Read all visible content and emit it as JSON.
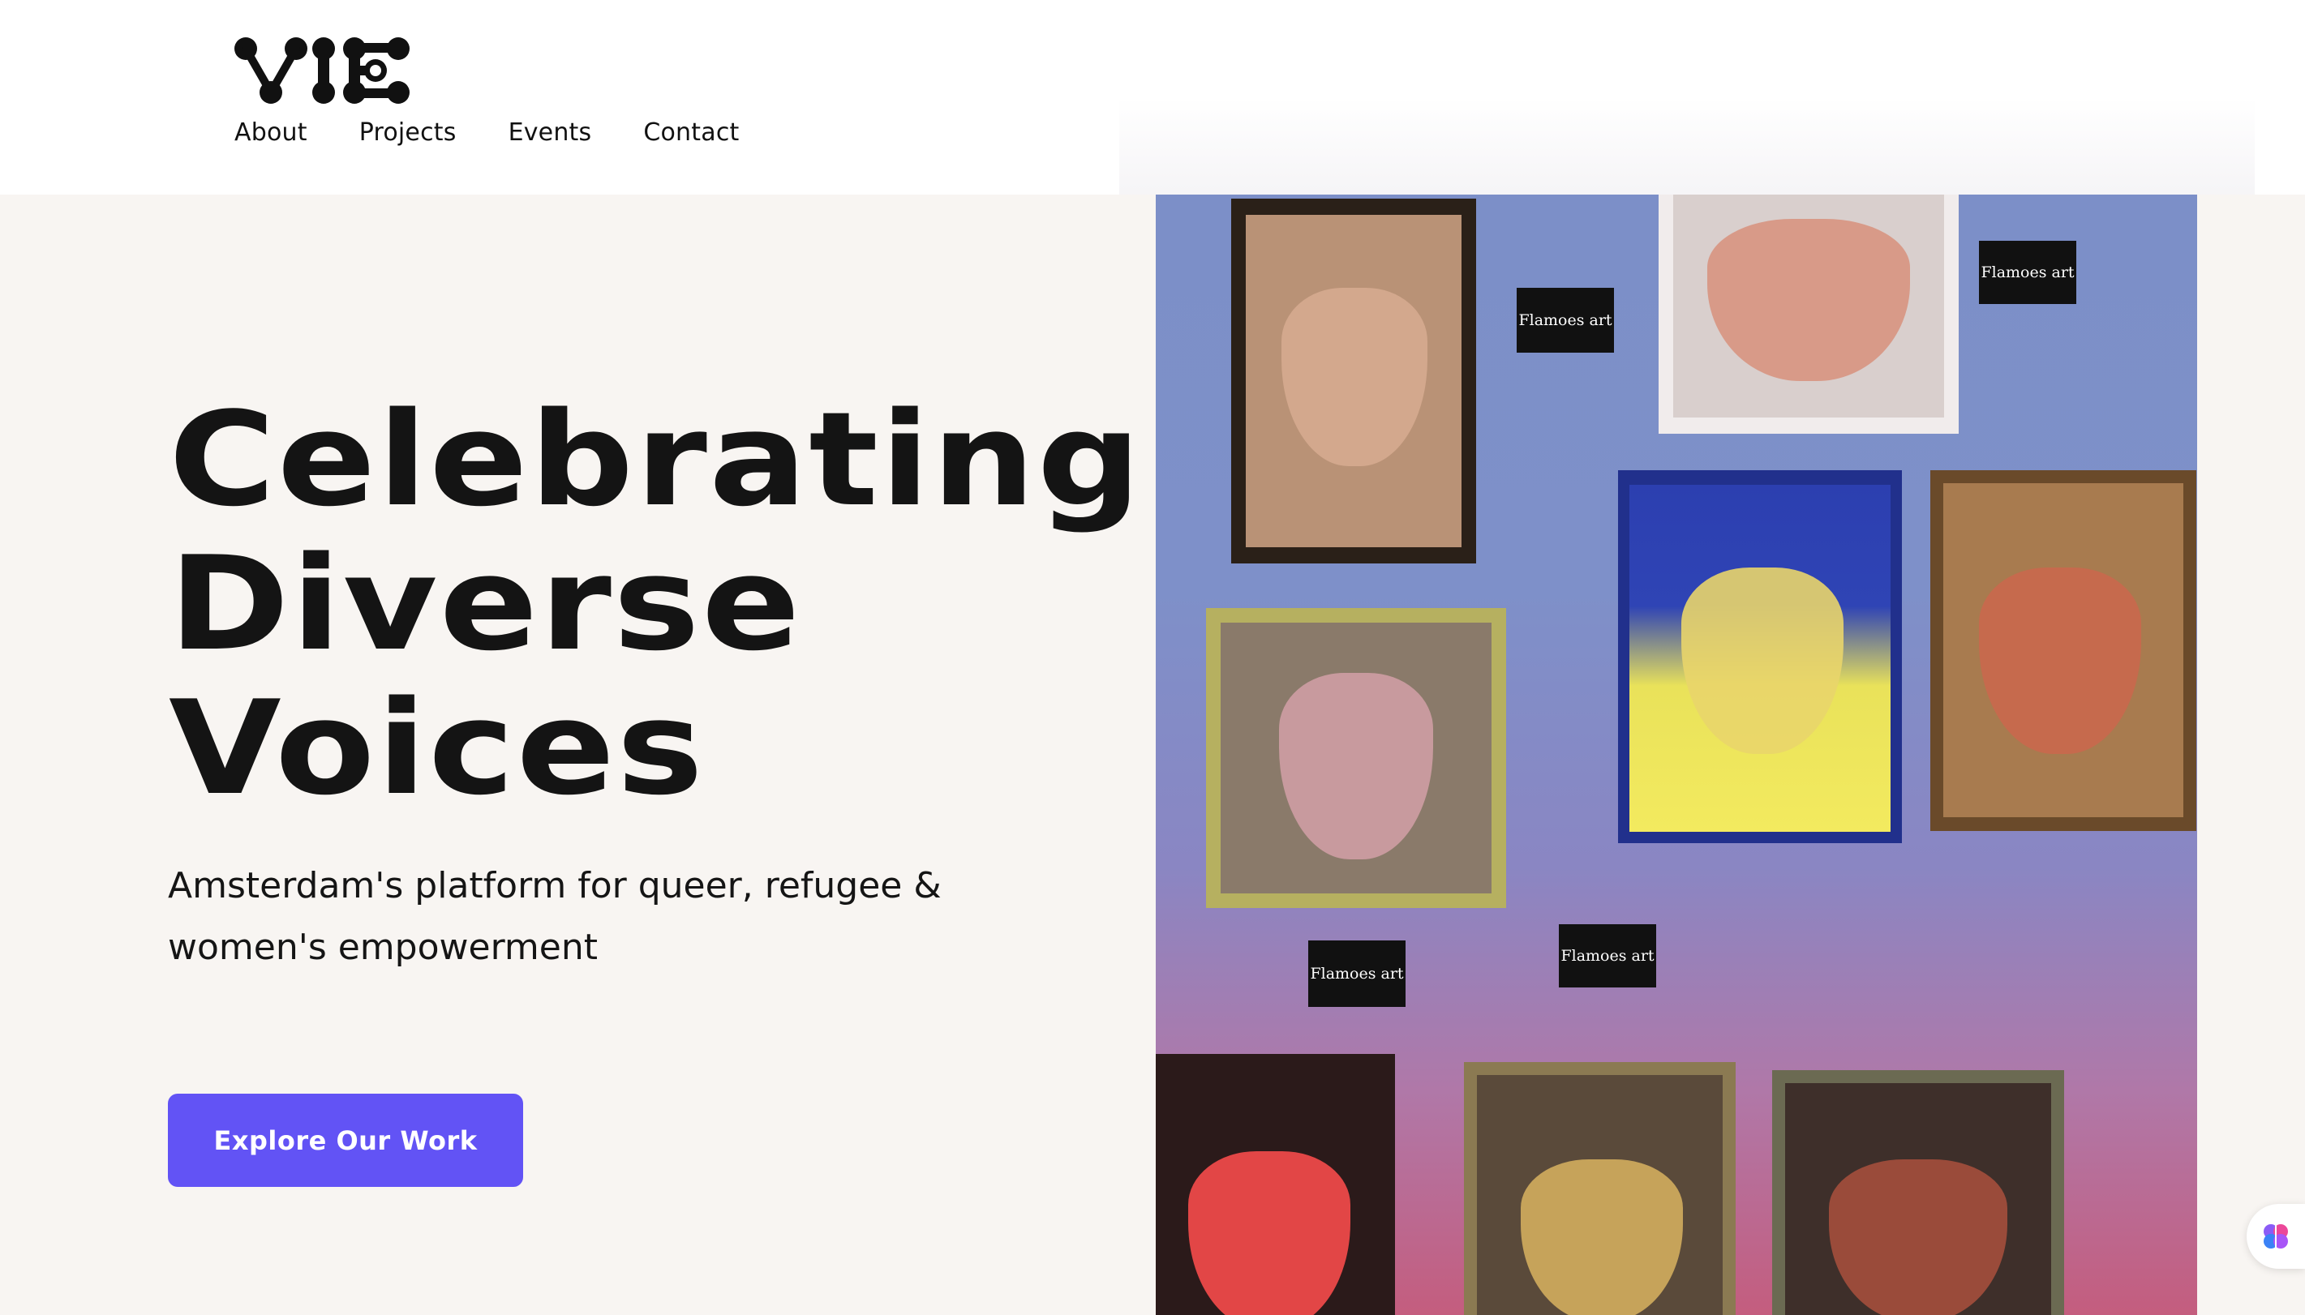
{
  "brand": {
    "logo_alt": "VIE"
  },
  "nav": {
    "items": [
      {
        "label": "About"
      },
      {
        "label": "Projects"
      },
      {
        "label": "Events"
      },
      {
        "label": "Contact"
      }
    ]
  },
  "hero": {
    "headline": [
      "Celebrating",
      "Diverse",
      "Voices"
    ],
    "subtitle": "Amsterdam's platform for queer, refugee & women's empowerment",
    "cta_label": "Explore Our Work"
  },
  "gallery": {
    "labels": [
      "Flamoes art",
      "Flamoes art",
      "Flamoes art",
      "Flamoes art"
    ]
  },
  "colors": {
    "accent": "#6253f5",
    "background": "#f8f5f2",
    "header": "#ffffff"
  },
  "icons": {
    "assistant": "brain-icon"
  }
}
